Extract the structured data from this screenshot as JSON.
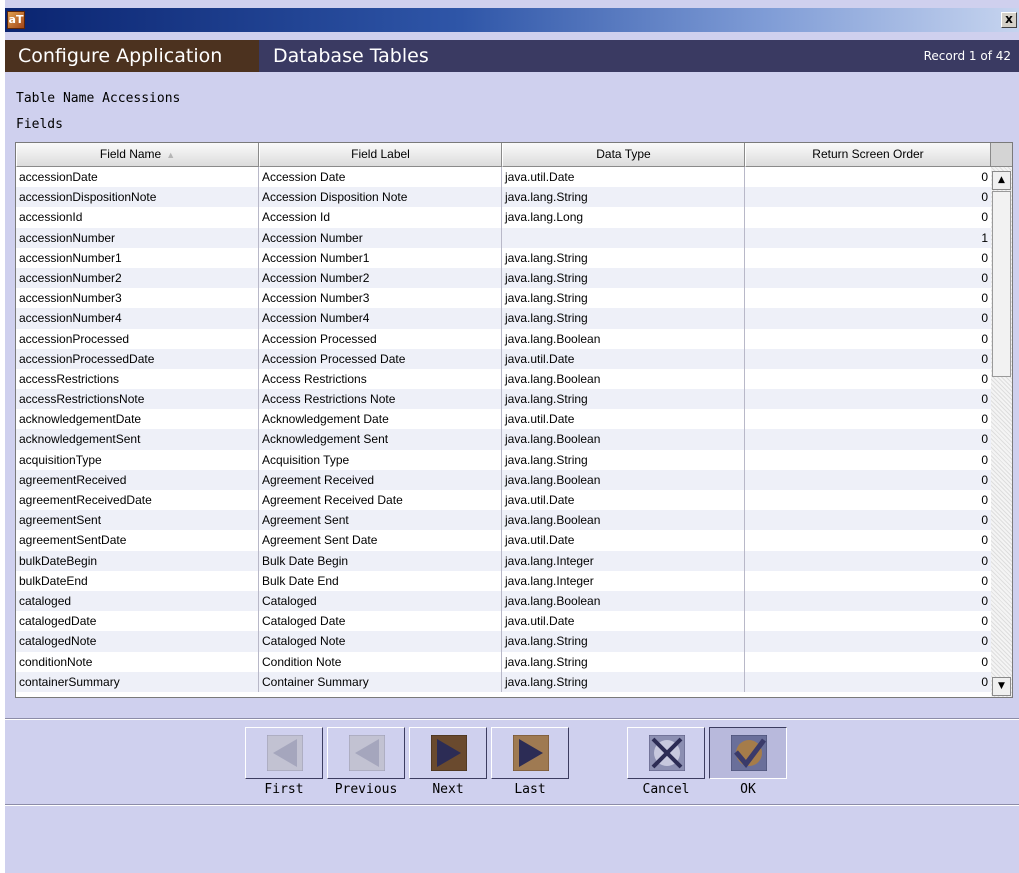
{
  "window": {
    "app_icon_text": "aT",
    "close_label": "x"
  },
  "header": {
    "app_title": "Configure Application",
    "section_title": "Database Tables",
    "record_status": "Record 1 of 42"
  },
  "table_name_label": "Table Name Accessions",
  "fields_label": "Fields",
  "table": {
    "columns": [
      "Field Name",
      "Field Label",
      "Data Type",
      "Return Screen Order"
    ],
    "sort_indicator": "▲",
    "rows": [
      [
        "accessionDate",
        "Accession Date",
        "java.util.Date",
        "0"
      ],
      [
        "accessionDispositionNote",
        "Accession Disposition Note",
        "java.lang.String",
        "0"
      ],
      [
        "accessionId",
        "Accession Id",
        "java.lang.Long",
        "0"
      ],
      [
        "accessionNumber",
        "Accession Number",
        "",
        "1"
      ],
      [
        "accessionNumber1",
        "Accession Number1",
        "java.lang.String",
        "0"
      ],
      [
        "accessionNumber2",
        "Accession Number2",
        "java.lang.String",
        "0"
      ],
      [
        "accessionNumber3",
        "Accession Number3",
        "java.lang.String",
        "0"
      ],
      [
        "accessionNumber4",
        "Accession Number4",
        "java.lang.String",
        "0"
      ],
      [
        "accessionProcessed",
        "Accession Processed",
        "java.lang.Boolean",
        "0"
      ],
      [
        "accessionProcessedDate",
        "Accession Processed Date",
        "java.util.Date",
        "0"
      ],
      [
        "accessRestrictions",
        "Access Restrictions",
        "java.lang.Boolean",
        "0"
      ],
      [
        "accessRestrictionsNote",
        "Access Restrictions Note",
        "java.lang.String",
        "0"
      ],
      [
        "acknowledgementDate",
        "Acknowledgement Date",
        "java.util.Date",
        "0"
      ],
      [
        "acknowledgementSent",
        "Acknowledgement Sent",
        "java.lang.Boolean",
        "0"
      ],
      [
        "acquisitionType",
        "Acquisition Type",
        "java.lang.String",
        "0"
      ],
      [
        "agreementReceived",
        "Agreement Received",
        "java.lang.Boolean",
        "0"
      ],
      [
        "agreementReceivedDate",
        "Agreement Received Date",
        "java.util.Date",
        "0"
      ],
      [
        "agreementSent",
        "Agreement Sent",
        "java.lang.Boolean",
        "0"
      ],
      [
        "agreementSentDate",
        "Agreement Sent Date",
        "java.util.Date",
        "0"
      ],
      [
        "bulkDateBegin",
        "Bulk Date Begin",
        "java.lang.Integer",
        "0"
      ],
      [
        "bulkDateEnd",
        "Bulk Date End",
        "java.lang.Integer",
        "0"
      ],
      [
        "cataloged",
        "Cataloged",
        "java.lang.Boolean",
        "0"
      ],
      [
        "catalogedDate",
        "Cataloged Date",
        "java.util.Date",
        "0"
      ],
      [
        "catalogedNote",
        "Cataloged Note",
        "java.lang.String",
        "0"
      ],
      [
        "conditionNote",
        "Condition Note",
        "java.lang.String",
        "0"
      ],
      [
        "containerSummary",
        "Container Summary",
        "java.lang.String",
        "0"
      ]
    ]
  },
  "buttons": {
    "first": "First",
    "previous": "Previous",
    "next": "Next",
    "last": "Last",
    "cancel": "Cancel",
    "ok": "OK"
  },
  "colors": {
    "background": "#cfd0ee",
    "header_band": "#3a3a62",
    "app_title_bg": "#4c321f"
  }
}
